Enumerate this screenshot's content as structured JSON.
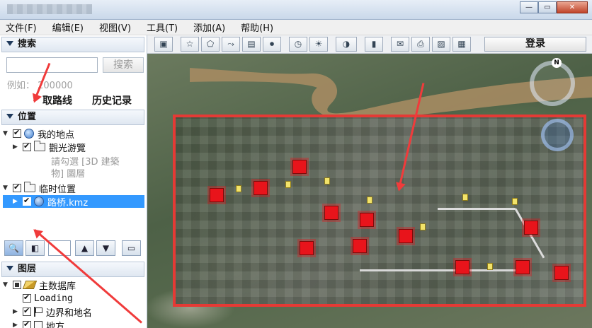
{
  "menu": [
    "文件(F)",
    "编辑(E)",
    "视图(V)",
    "工具(T)",
    "添加(A)",
    "帮助(H)"
  ],
  "search": {
    "header": "搜索",
    "button": "搜索",
    "hint": "例如： 200000",
    "links": [
      "取路线",
      "历史记录"
    ]
  },
  "places": {
    "header": "位置",
    "items": [
      {
        "label": "我的地点"
      },
      {
        "label": "觀光游覽"
      },
      {
        "label": "請勾選 [3D 建築"
      },
      {
        "label": "物] 圖層"
      },
      {
        "label": "临时位置"
      },
      {
        "label": "路桥.kmz"
      }
    ]
  },
  "layers": {
    "header": "图层",
    "items": [
      {
        "label": "主数据库"
      },
      {
        "label": "Loading"
      },
      {
        "label": "边界和地名"
      },
      {
        "label": "地方"
      }
    ]
  },
  "toolbar": {
    "login": "登录"
  },
  "map": {
    "compass_north": "N"
  },
  "colors": {
    "highlight": "#3399ff",
    "frame": "#e53a35",
    "arrow": "#f03b3b"
  }
}
